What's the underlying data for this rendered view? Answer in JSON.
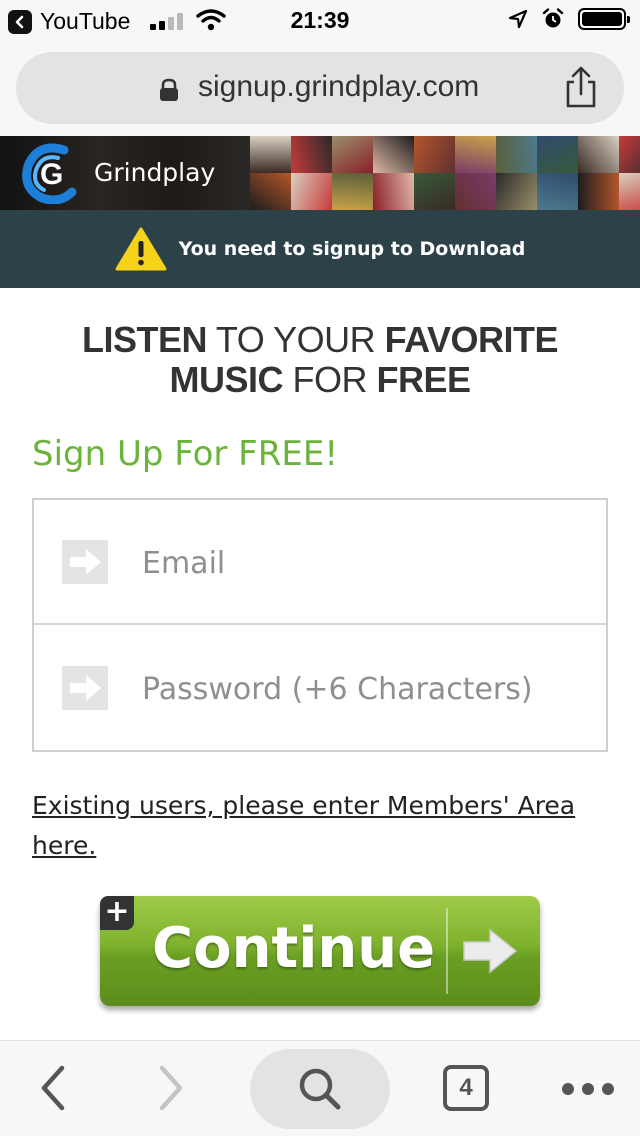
{
  "status_bar": {
    "back_app": "YouTube",
    "time": "21:39"
  },
  "browser": {
    "url": "signup.grindplay.com",
    "open_tabs": "4"
  },
  "banner": {
    "brand": "Grindplay",
    "logo_letter": "G"
  },
  "notice": {
    "text": "You need to signup to Download"
  },
  "headline": {
    "line1_bold_a": "LISTEN",
    "line1_mid": " TO YOUR ",
    "line1_bold_b": "FAVORITE",
    "line2_bold_a": "MUSIC",
    "line2_mid": " FOR ",
    "line2_bold_b": "FREE"
  },
  "signup": {
    "title": "Sign Up For FREE!",
    "email_placeholder": "Email",
    "password_placeholder": "Password (+6 Characters)",
    "members_link": "Existing users, please enter Members' Area here.",
    "continue_label": "Continue",
    "plus_badge": "+"
  },
  "colors": {
    "accent_green": "#6ab43a",
    "notice_bg": "#2d4149",
    "button_green": "#7eb12d",
    "warning_yellow": "#f5d31a"
  },
  "icons": {
    "status": [
      "chevron-left-icon",
      "signal-icon",
      "wifi-icon",
      "location-icon",
      "alarm-icon",
      "battery-icon"
    ],
    "url": [
      "lock-icon",
      "share-icon"
    ],
    "form": [
      "arrow-right-icon"
    ],
    "toolbar": [
      "back-icon",
      "forward-icon",
      "search-icon",
      "tabs-icon",
      "more-icon"
    ]
  }
}
